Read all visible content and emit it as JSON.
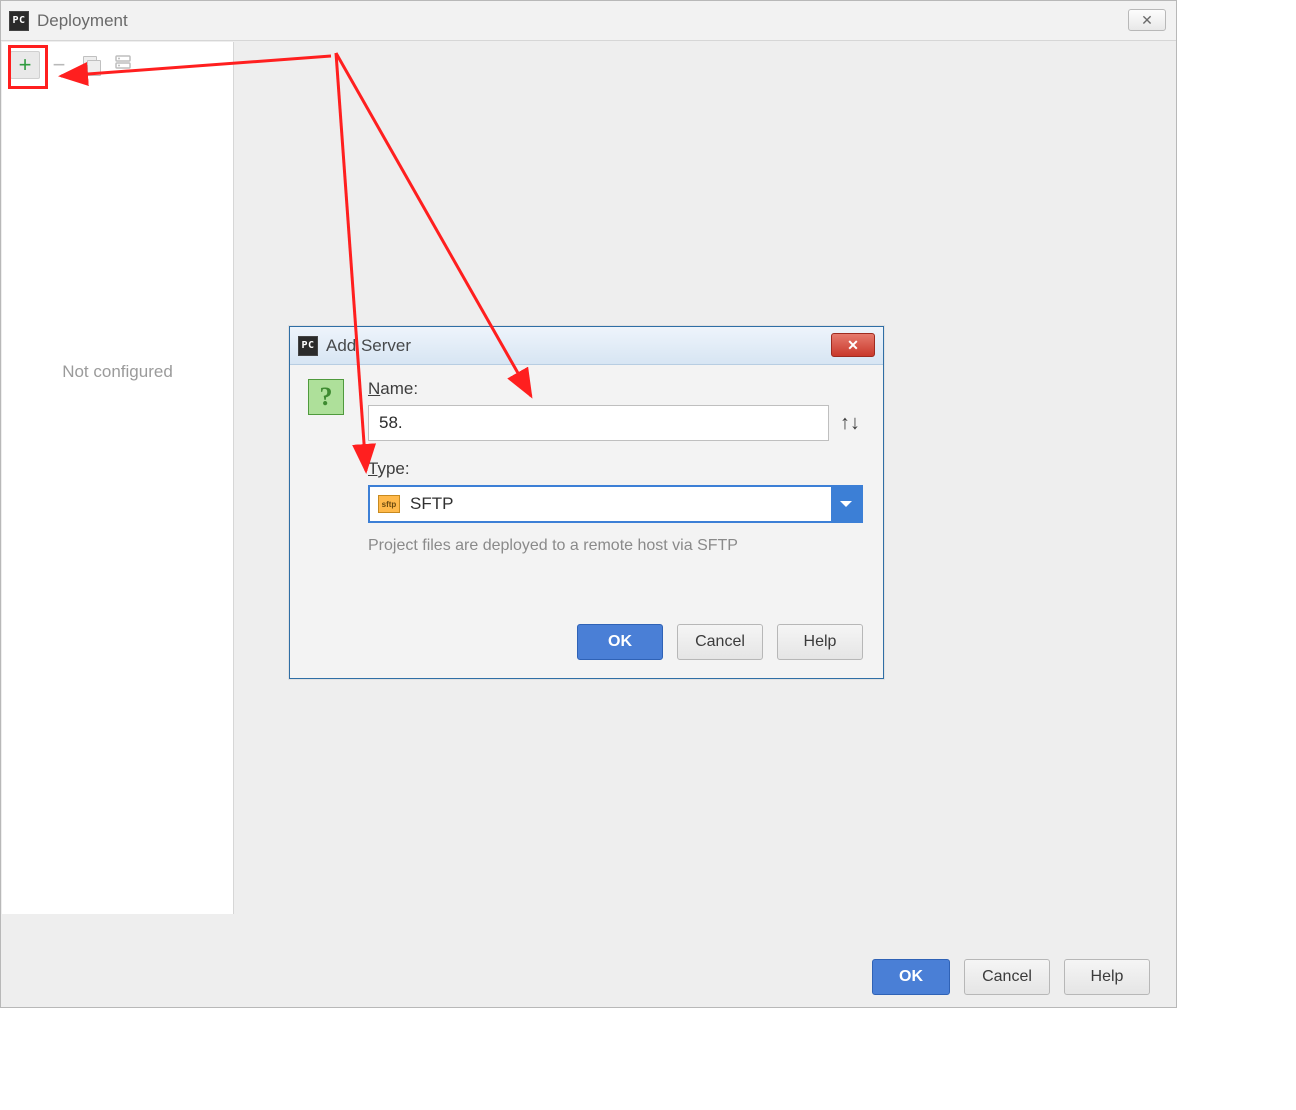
{
  "window": {
    "title": "Deployment",
    "close_glyph": "✕"
  },
  "toolbar": {
    "add_glyph": "+",
    "minus_glyph": "−"
  },
  "sidebar": {
    "placeholder": "Not configured"
  },
  "dialog": {
    "title": "Add Server",
    "close_glyph": "✕",
    "help_glyph": "?",
    "name_label": "Name:",
    "name_prefix_underline": "N",
    "name_value": "58.",
    "sort_glyph": "↑↓",
    "type_label": "Type:",
    "type_prefix_underline": "T",
    "type_icon_text": "sftp",
    "type_selected": "SFTP",
    "hint": "Project files are deployed to a remote host via SFTP",
    "ok": "OK",
    "cancel": "Cancel",
    "help": "Help"
  },
  "bottom": {
    "ok": "OK",
    "cancel": "Cancel",
    "help": "Help"
  }
}
